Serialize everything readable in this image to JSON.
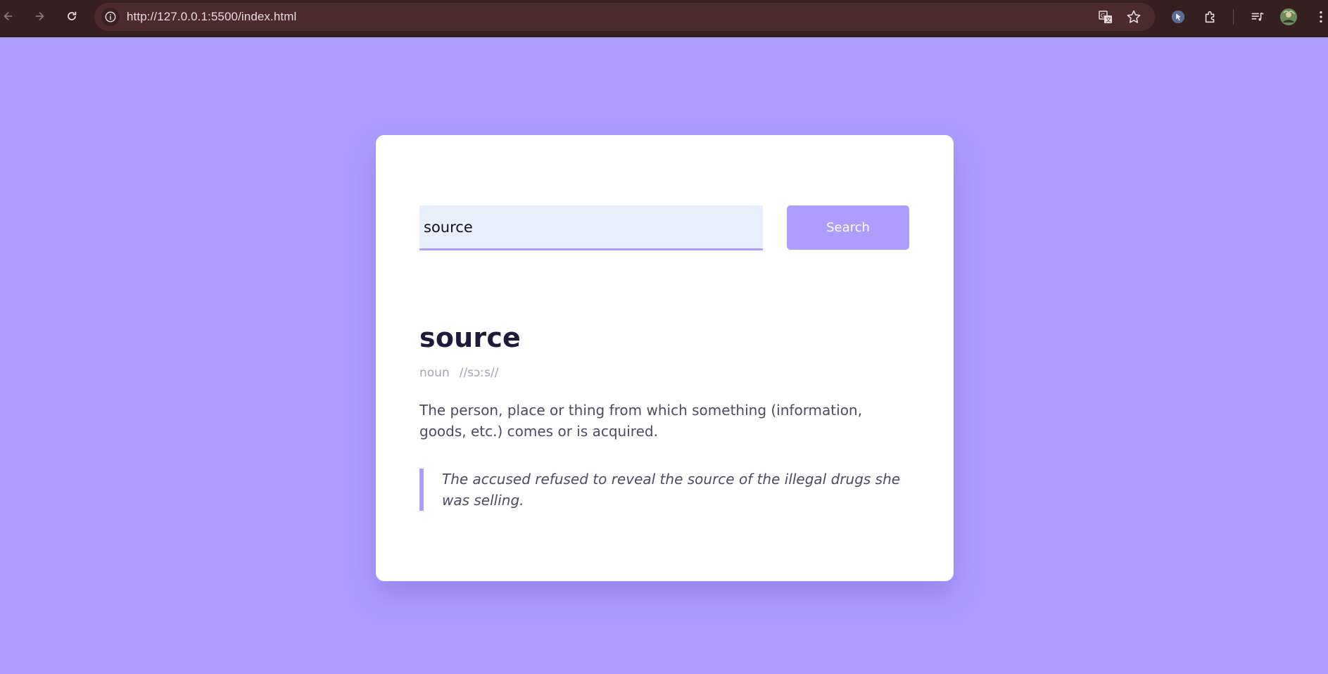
{
  "browser": {
    "url": "http://127.0.0.1:5500/index.html",
    "icons": {
      "back": "back-arrow-icon",
      "forward": "forward-arrow-icon",
      "reload": "reload-icon",
      "site_info": "info-icon",
      "translate": "translate-icon",
      "bookmark": "star-icon",
      "extension": "cursor-extension-icon",
      "extensions": "puzzle-icon",
      "media": "media-control-icon",
      "profile": "avatar",
      "menu": "kebab-menu-icon"
    }
  },
  "colors": {
    "background": "#ae9cff",
    "accent": "#ae9cff",
    "heading": "#1d1a3b",
    "body_text": "#4b4b63",
    "muted": "#a3a3b4",
    "input_bg": "#e8effd"
  },
  "search": {
    "value": "source",
    "button_label": "Search"
  },
  "result": {
    "word": "source",
    "part_of_speech": "noun",
    "phonetic": "//sɔːs//",
    "definition": "The person, place or thing from which something (information, goods, etc.) comes or is acquired.",
    "example": "The accused refused to reveal the source of the illegal drugs she was selling."
  }
}
